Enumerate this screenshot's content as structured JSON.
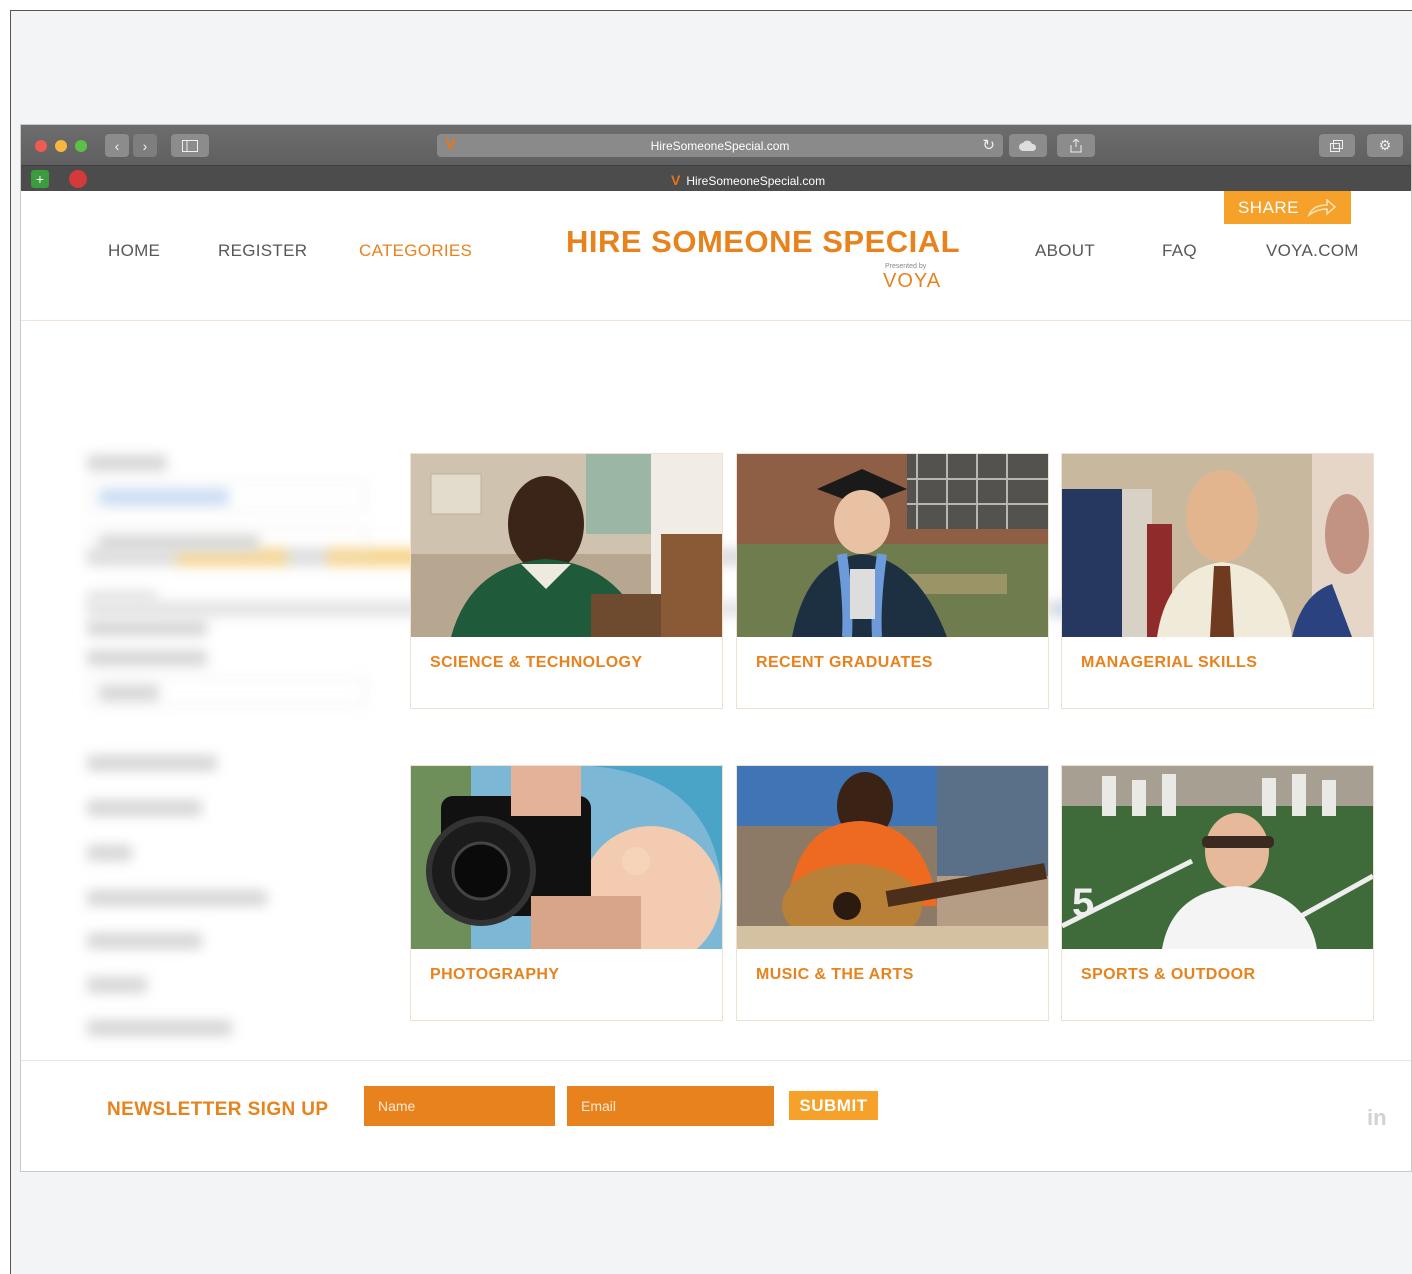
{
  "browser": {
    "url": "HireSomeoneSpecial.com",
    "tab_title": "HireSomeoneSpecial.com"
  },
  "header": {
    "nav_left": [
      {
        "label": "HOME",
        "active": false
      },
      {
        "label": "REGISTER",
        "active": false
      },
      {
        "label": "CATEGORIES",
        "active": true
      }
    ],
    "nav_right": [
      {
        "label": "ABOUT"
      },
      {
        "label": "FAQ"
      },
      {
        "label": "VOYA.COM"
      }
    ],
    "site_title": "HIRE SOMEONE SPECIAL",
    "presented_by": "Presented by",
    "brand": "VOYA",
    "share_label": "SHARE"
  },
  "categories": [
    {
      "label": "SCIENCE & TECHNOLOGY",
      "icon": "photo-man-green-sweater"
    },
    {
      "label": "RECENT GRADUATES",
      "icon": "photo-graduate"
    },
    {
      "label": "MANAGERIAL SKILLS",
      "icon": "photo-man-tie"
    },
    {
      "label": "PHOTOGRAPHY",
      "icon": "photo-camera"
    },
    {
      "label": "MUSIC & THE ARTS",
      "icon": "photo-guitar"
    },
    {
      "label": "SPORTS & OUTDOOR",
      "icon": "photo-football-field"
    }
  ],
  "footer": {
    "newsletter_title": "NEWSLETTER SIGN UP",
    "name_placeholder": "Name",
    "email_placeholder": "Email",
    "submit_label": "SUBMIT",
    "social_icon": "linkedin-icon"
  },
  "colors": {
    "accent": "#e8821c",
    "share": "#f5a12a"
  }
}
